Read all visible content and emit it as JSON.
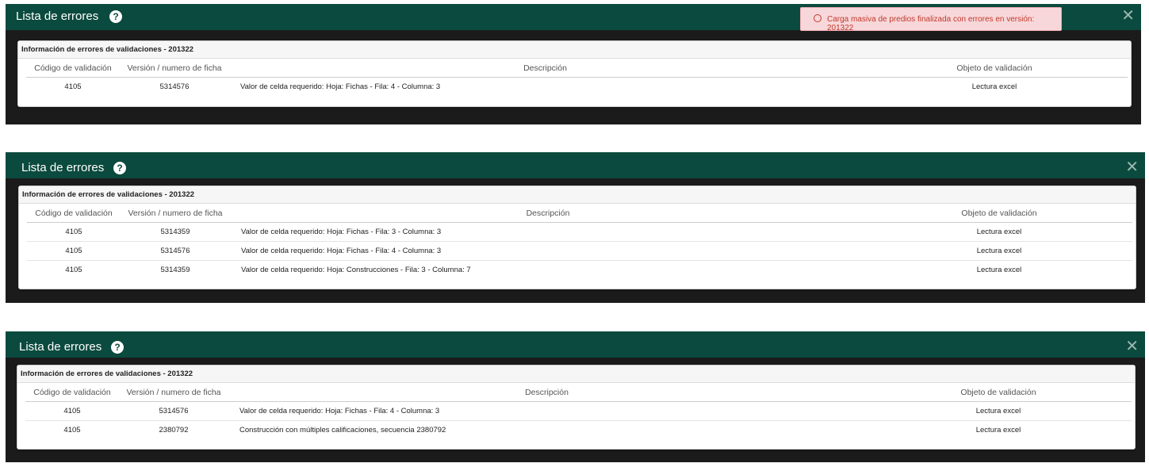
{
  "colors": {
    "header_bg": "#0b4a3e",
    "toast_bg": "#f8d7da",
    "toast_text": "#c0392b",
    "frame_bg": "#1b1b1b"
  },
  "icons": {
    "help": "help-circle-icon",
    "close": "close-icon",
    "toast": "error-circle-icon"
  },
  "columns": {
    "code": "Código de validación",
    "version": "Versión / numero de ficha",
    "description": "Descripción",
    "object": "Objeto de validación"
  },
  "modals": [
    {
      "title": "Lista de errores",
      "help_glyph": "?",
      "close_glyph": "✕",
      "toast": "Carga masiva de predios finalizada con errores en versión: 201322",
      "panel_title": "Información de errores de validaciones - 201322",
      "rows": [
        {
          "code": "4105",
          "version": "5314576",
          "description": "Valor de celda requerido: Hoja: Fichas - Fila: 4 - Columna: 3",
          "object": "Lectura excel"
        }
      ]
    },
    {
      "title": "Lista de errores",
      "help_glyph": "?",
      "close_glyph": "✕",
      "panel_title": "Información de errores de validaciones - 201322",
      "rows": [
        {
          "code": "4105",
          "version": "5314359",
          "description": "Valor de celda requerido: Hoja: Fichas - Fila: 3 - Columna: 3",
          "object": "Lectura excel"
        },
        {
          "code": "4105",
          "version": "5314576",
          "description": "Valor de celda requerido: Hoja: Fichas - Fila: 4 - Columna: 3",
          "object": "Lectura excel"
        },
        {
          "code": "4105",
          "version": "5314359",
          "description": "Valor de celda requerido: Hoja: Construcciones - Fila: 3 - Columna: 7",
          "object": "Lectura excel"
        }
      ]
    },
    {
      "title": "Lista de errores",
      "help_glyph": "?",
      "close_glyph": "✕",
      "panel_title": "Información de errores de validaciones - 201322",
      "rows": [
        {
          "code": "4105",
          "version": "5314576",
          "description": "Valor de celda requerido: Hoja: Fichas - Fila: 4 - Columna: 3",
          "object": "Lectura excel"
        },
        {
          "code": "4105",
          "version": "2380792",
          "description": "Construcción con múltiples calificaciones, secuencia 2380792",
          "object": "Lectura excel"
        }
      ]
    }
  ]
}
